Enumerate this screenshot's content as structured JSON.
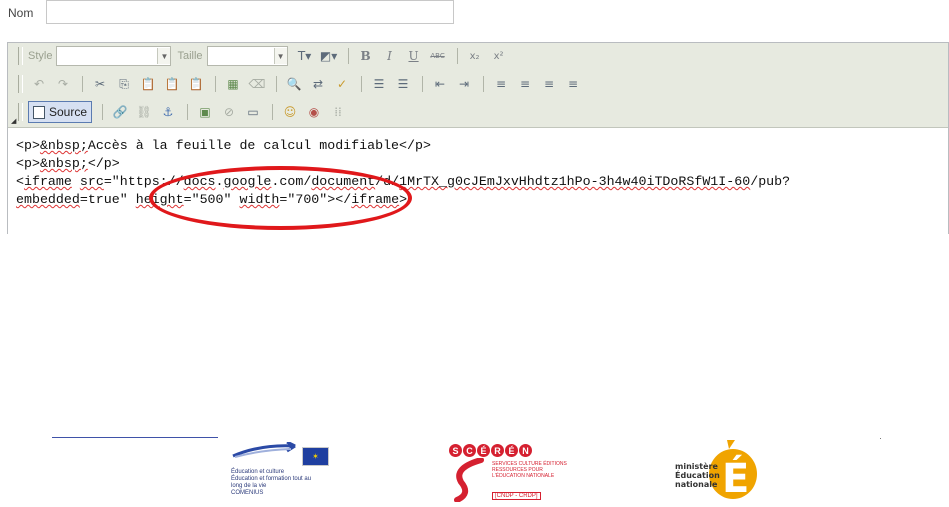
{
  "form": {
    "nom_label": "Nom",
    "nom_value": ""
  },
  "toolbar": {
    "style_label": "Style",
    "size_label": "Taille",
    "bold": "B",
    "italic": "I",
    "underline": "U",
    "strike": "ABC",
    "subscript": "x₂",
    "superscript": "x²",
    "source_label": "Source"
  },
  "source": {
    "line1_open": "<p>",
    "line1_entity": "&nbsp;",
    "line1_rest": "Accès à la feuille de calcul modifiable</p>",
    "line2_open": "<p>",
    "line2_entity": "&nbsp;",
    "line2_rest": "</p>",
    "line3_tag_start": "<",
    "line3_tag": "iframe",
    "line3_space": " ",
    "line3_src": "src",
    "line3_eq": "=\"https://",
    "line3_docs": "docs",
    "line3_dot": ".",
    "line3_google": "google",
    "line3_com": ".com/",
    "line3_document": "document",
    "line3_d": "/d/",
    "line3_id": "1MrTX_g0cJEmJxvHhdtz1hPo-3h4w40iTDoRSfW1I-60",
    "line3_end": "/pub?",
    "line4_embedded": "embedded",
    "line4_eq_true": "=true\"",
    "line4_sp1": " ",
    "line4_height": "height",
    "line4_hval": "=\"500\"",
    "line4_sp2": " ",
    "line4_width": "width",
    "line4_wval": "=\"700\"",
    "line4_close": "></",
    "line4_iframe": "iframe",
    "line4_gt": ">"
  },
  "icons": {
    "colors": {
      "accent_red": "#e0181b",
      "toolbar_bg": "#e7eae0",
      "source_active": "#d6e0f2"
    }
  },
  "footer": {
    "eu_lines": [
      "Éducation et culture",
      "Éducation et formation tout au",
      "long de la vie",
      "COMENIUS"
    ],
    "sceren_letters": [
      "S",
      "C",
      "É",
      "R",
      "É",
      "N"
    ],
    "sceren_lines": [
      "SERVICES CULTURE ÉDITIONS",
      "RESSOURCES POUR",
      "L'ÉDUCATION NATIONALE"
    ],
    "sceren_cndp": "[CNDP - CRDP]",
    "ministere_lines": [
      "ministère",
      "Éducation",
      "nationale"
    ],
    "ministere_letter": "É"
  }
}
